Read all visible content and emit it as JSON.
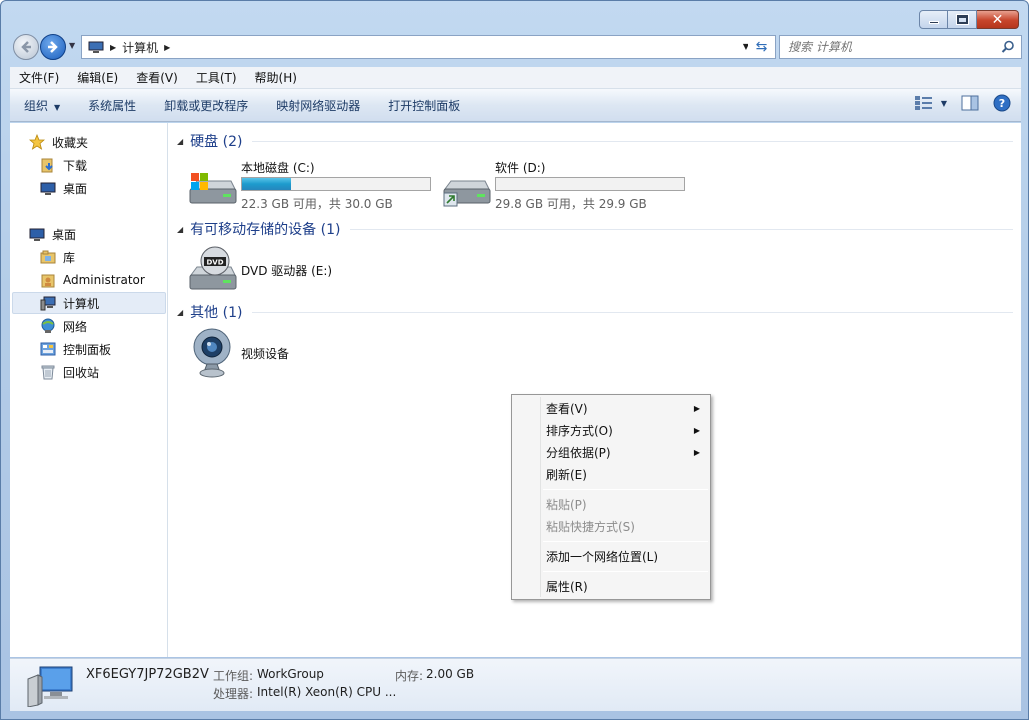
{
  "window": {
    "caption": {
      "minimize": "minimize",
      "maximize": "maximize",
      "close": "close"
    }
  },
  "address": {
    "path": "计算机",
    "search_placeholder": "搜索 计算机"
  },
  "menubar": {
    "items": [
      "文件(F)",
      "编辑(E)",
      "查看(V)",
      "工具(T)",
      "帮助(H)"
    ]
  },
  "commandbar": {
    "items": [
      "组织",
      "系统属性",
      "卸载或更改程序",
      "映射网络驱动器",
      "打开控制面板"
    ]
  },
  "navpane": {
    "favorites": "收藏夹",
    "downloads": "下载",
    "desktop_fav": "桌面",
    "desktop": "桌面",
    "library": "库",
    "administrator": "Administrator",
    "computer": "计算机",
    "network": "网络",
    "control_panel": "控制面板",
    "recycle_bin": "回收站"
  },
  "groups": {
    "hdd": "硬盘 (2)",
    "removable": "有可移动存储的设备 (1)",
    "other": "其他 (1)"
  },
  "drives": [
    {
      "name": "本地磁盘 (C:)",
      "free_text": "22.3 GB 可用，共 30.0 GB",
      "used_fraction": 0.26
    },
    {
      "name": "软件 (D:)",
      "free_text": "29.8 GB 可用，共 29.9 GB",
      "used_fraction": 0.0
    }
  ],
  "dvd": {
    "name": "DVD 驱动器 (E:)"
  },
  "other": {
    "name": "视频设备"
  },
  "details": {
    "computer_name": "XF6EGY7JP72GB2V",
    "workgroup_label": "工作组:",
    "workgroup_value": "WorkGroup",
    "memory_label": "内存:",
    "memory_value": "2.00 GB",
    "cpu_label": "处理器:",
    "cpu_value": "Intel(R) Xeon(R) CPU ..."
  },
  "context_menu": {
    "view": "查看(V)",
    "sort": "排序方式(O)",
    "group": "分组依据(P)",
    "refresh": "刷新(E)",
    "paste": "粘贴(P)",
    "paste_shortcut": "粘贴快捷方式(S)",
    "add_network": "添加一个网络位置(L)",
    "properties": "属性(R)"
  }
}
